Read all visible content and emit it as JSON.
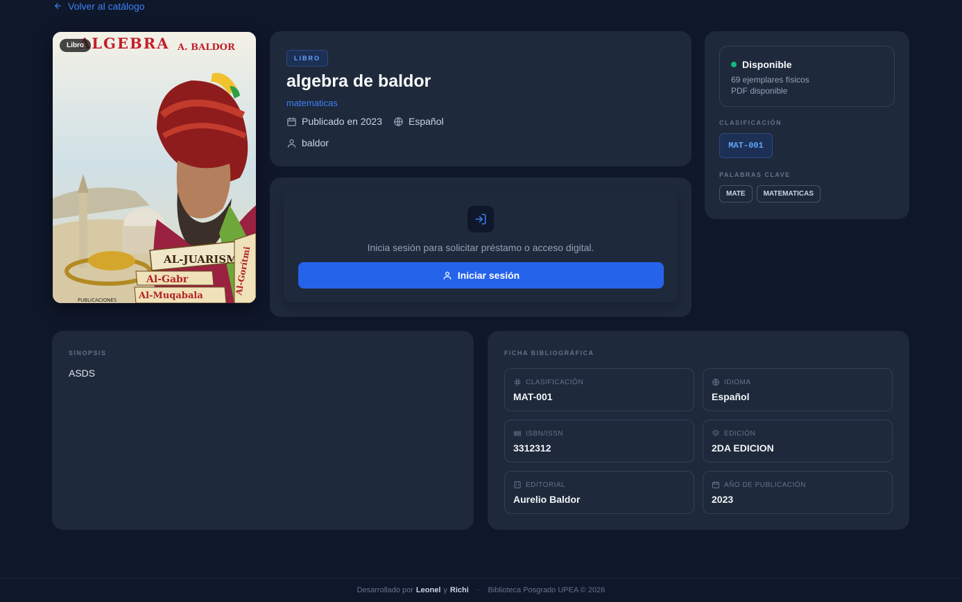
{
  "nav": {
    "back_label": "Volver al catálogo"
  },
  "cover": {
    "badge": "Libro",
    "title_text": "ALGEBRA",
    "author_text": "A. BALDOR",
    "banner_text": "AL-JUARISMI",
    "scroll_text_1": "Al-Gabr",
    "scroll_text_2": "Al-Muqabala",
    "scroll_text_3": "Al-Gorítmi",
    "publisher_text": "PUBLICACIONES"
  },
  "book": {
    "type": "LIBRO",
    "title": "algebra de baldor",
    "subject": "matematicas",
    "published": "Publicado en 2023",
    "language": "Español",
    "author": "baldor"
  },
  "login": {
    "message": "Inicia sesión para solicitar préstamo o acceso digital.",
    "button_label": "Iniciar sesión"
  },
  "availability": {
    "status": "Disponible",
    "status_color": "#10b981",
    "copies": "69 ejemplares físicos",
    "pdf": "PDF disponible"
  },
  "classification": {
    "label": "CLASIFICACIÓN",
    "code": "MAT-001"
  },
  "keywords": {
    "label": "PALABRAS CLAVE",
    "items": [
      "MATE",
      "MATEMATICAS"
    ]
  },
  "sinopsis": {
    "label": "SINOPSIS",
    "text": "ASDS"
  },
  "ficha": {
    "label": "FICHA BIBLIOGRÁFICA",
    "fields": [
      {
        "label": "CLASIFICACIÓN",
        "value": "MAT-001",
        "icon": "hash-icon"
      },
      {
        "label": "IDIOMA",
        "value": "Español",
        "icon": "globe-icon"
      },
      {
        "label": "ISBN/ISSN",
        "value": "3312312",
        "icon": "barcode-icon"
      },
      {
        "label": "EDICIÓN",
        "value": "2DA EDICION",
        "icon": "layers-icon"
      },
      {
        "label": "EDITORIAL",
        "value": "Aurelio Baldor",
        "icon": "building-icon"
      },
      {
        "label": "AÑO DE PUBLICACIÓN",
        "value": "2023",
        "icon": "calendar-icon"
      }
    ]
  },
  "footer": {
    "prefix": "Desarrollado por",
    "dev1": "Leonel",
    "conj": "y",
    "dev2": "Richi",
    "separator": "·",
    "credit": "Biblioteca Posgrado UPEA © 2026"
  },
  "colors": {
    "background": "#0f172a",
    "card": "#1e293b",
    "accent": "#2563eb",
    "link": "#3b82f6"
  }
}
